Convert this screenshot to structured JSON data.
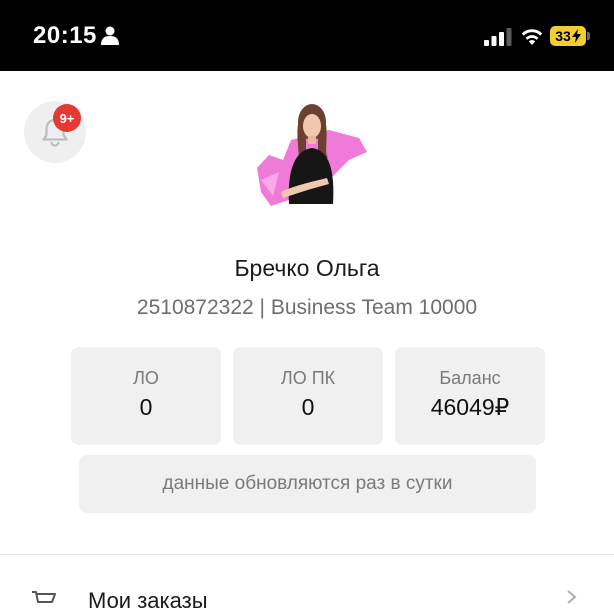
{
  "status_bar": {
    "time": "20:15",
    "battery": "33",
    "icons": [
      "person-icon",
      "signal-icon",
      "wifi-icon",
      "battery-icon"
    ]
  },
  "notifications": {
    "badge": "9+",
    "icon": "bell-icon"
  },
  "profile": {
    "name": "Бречко Ольга",
    "subtitle": "2510872322 | Business Team 10000"
  },
  "stats": [
    {
      "label": "ЛО",
      "value": "0"
    },
    {
      "label": "ЛО ПК",
      "value": "0"
    },
    {
      "label": "Баланс",
      "value": "46049₽"
    }
  ],
  "info": {
    "text": "данные обновляются раз в сутки"
  },
  "menu": {
    "items": [
      {
        "label": "Мои заказы",
        "icon": "cart-icon"
      }
    ]
  },
  "colors": {
    "status_bar_bg": "#000000",
    "battery": "#f2cd34",
    "badge": "#e53935",
    "card_bg": "#f0f0f0",
    "avatar_accent": "#f07ad8"
  }
}
